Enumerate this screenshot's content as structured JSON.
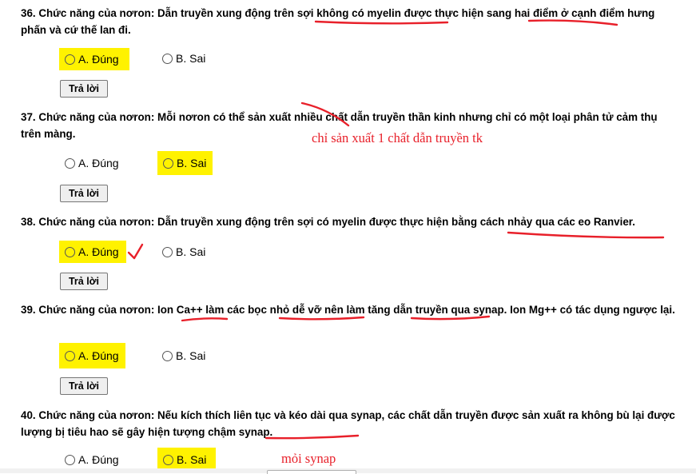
{
  "questions": [
    {
      "text": "36. Chức năng của nơron: Dẫn truyền xung động trên sợi không có myelin được thực hiện sang hai điểm ở cạnh điểm hưng phấn và cứ thế lan đi.",
      "option_a": "A. Đúng",
      "option_b": "B. Sai",
      "highlighted": "A",
      "button": "Trả lời"
    },
    {
      "text": "37. Chức năng của nơron: Mỗi nơron có thể sản xuất nhiều chất dẫn truyền thần kinh nhưng chỉ có một loại phân tử cảm thụ trên màng.",
      "option_a": "A. Đúng",
      "option_b": "B. Sai",
      "highlighted": "B",
      "button": "Trả lời",
      "handwritten_note": "chỉ sản xuất 1 chất dẫn truyền tk"
    },
    {
      "text": "38. Chức năng của nơron: Dẫn truyền xung động trên sợi có myelin được thực hiện bằng cách nhảy qua các eo Ranvier.",
      "option_a": "A. Đúng",
      "option_b": "B. Sai",
      "highlighted": "A",
      "button": "Trả lời"
    },
    {
      "text": "39. Chức năng của nơron: Ion Ca++ làm các bọc nhỏ dễ vỡ nên làm tăng dẫn truyền qua synap. Ion Mg++ có tác dụng ngược lại.",
      "option_a": "A. Đúng",
      "option_b": "B. Sai",
      "highlighted": "A",
      "button": "Trả lời"
    },
    {
      "text": "40. Chức năng của nơron: Nếu kích thích liên tục và kéo dài qua synap, các chất dẫn truyền được sản xuất ra không bù lại được lượng bị tiêu hao sẽ gây hiện tượng chậm synap.",
      "option_a": "A. Đúng",
      "option_b": "B. Sai",
      "highlighted": "B",
      "handwritten_note": "mỏi synap"
    }
  ],
  "colors": {
    "highlight": "#fff200",
    "annotation_ink": "#e8202a"
  }
}
